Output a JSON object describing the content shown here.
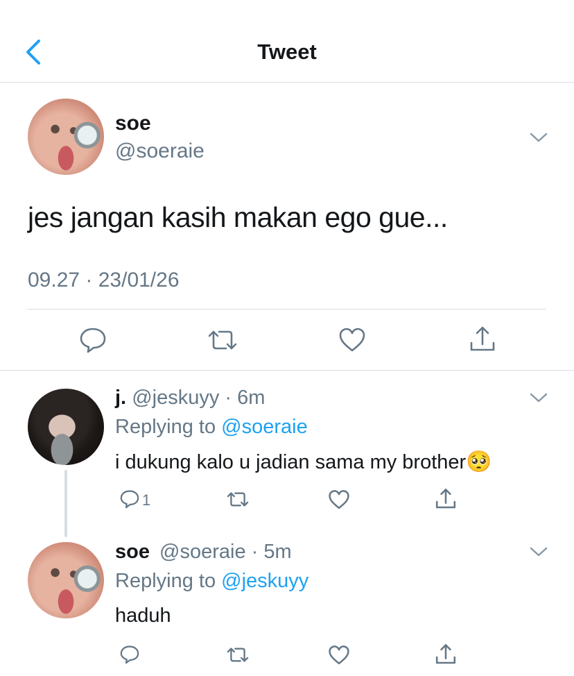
{
  "header": {
    "title": "Tweet",
    "back_icon": "chevron-left-icon"
  },
  "main_tweet": {
    "display_name": "soe",
    "handle": "@soeraie",
    "text": "jes jangan kasih makan ego gue...",
    "timestamp": "09.27 · 23/01/26",
    "actions": [
      "reply-icon",
      "retweet-icon",
      "like-icon",
      "share-icon"
    ]
  },
  "replies": [
    {
      "display_name": "j.",
      "handle": "@jeskuyy",
      "time": "6m",
      "replying_label": "Replying to",
      "replying_to": "@soeraie",
      "text": "i dukung kalo u jadian sama my brother",
      "emoji": "🥺",
      "reply_count": "1"
    },
    {
      "display_name": "soe",
      "handle": "@soeraie",
      "time": "5m",
      "replying_label": "Replying to",
      "replying_to": "@jeskuyy",
      "text": "haduh"
    }
  ],
  "colors": {
    "accent": "#1da1f2",
    "muted": "#657786",
    "divider": "#d8dde1",
    "text": "#14171a"
  }
}
